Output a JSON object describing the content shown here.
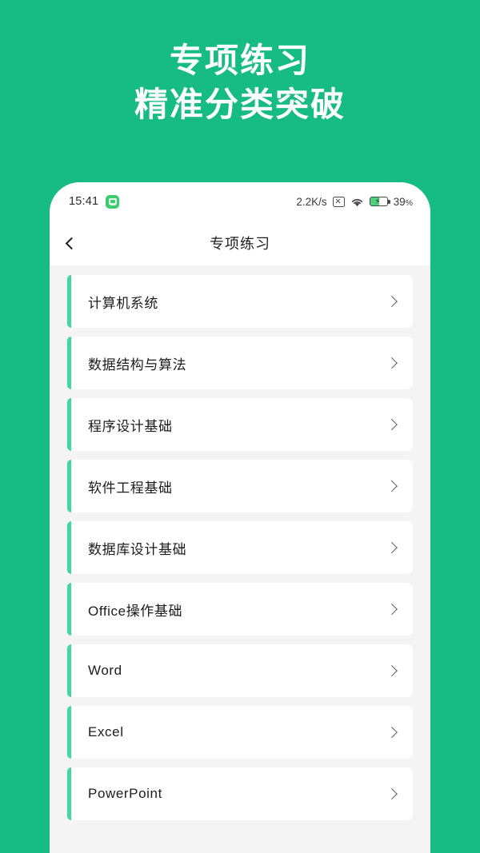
{
  "promo": {
    "line1": "专项练习",
    "line2": "精准分类突破"
  },
  "theme": {
    "background_green": "#17bc85",
    "accent_green": "#42d79c",
    "card_background": "#ffffff",
    "content_background": "#f4f4f4",
    "text_color": "#1c1c1c"
  },
  "statusbar": {
    "time": "15:41",
    "app_icon": "android-app-icon",
    "network_speed": "2.2K/s",
    "no_signal_icon": "no-sim-signal-icon",
    "wifi_icon": "wifi-icon",
    "battery_icon": "battery-charging-icon",
    "battery_level": "39",
    "battery_unit": "%"
  },
  "navbar": {
    "back_icon": "chevron-left-icon",
    "title": "专项练习"
  },
  "list": {
    "chevron_icon": "chevron-right-icon",
    "items": [
      {
        "label": "计算机系统"
      },
      {
        "label": "数据结构与算法"
      },
      {
        "label": "程序设计基础"
      },
      {
        "label": "软件工程基础"
      },
      {
        "label": "数据库设计基础"
      },
      {
        "label": "Office操作基础"
      },
      {
        "label": "Word"
      },
      {
        "label": "Excel"
      },
      {
        "label": "PowerPoint"
      }
    ]
  }
}
